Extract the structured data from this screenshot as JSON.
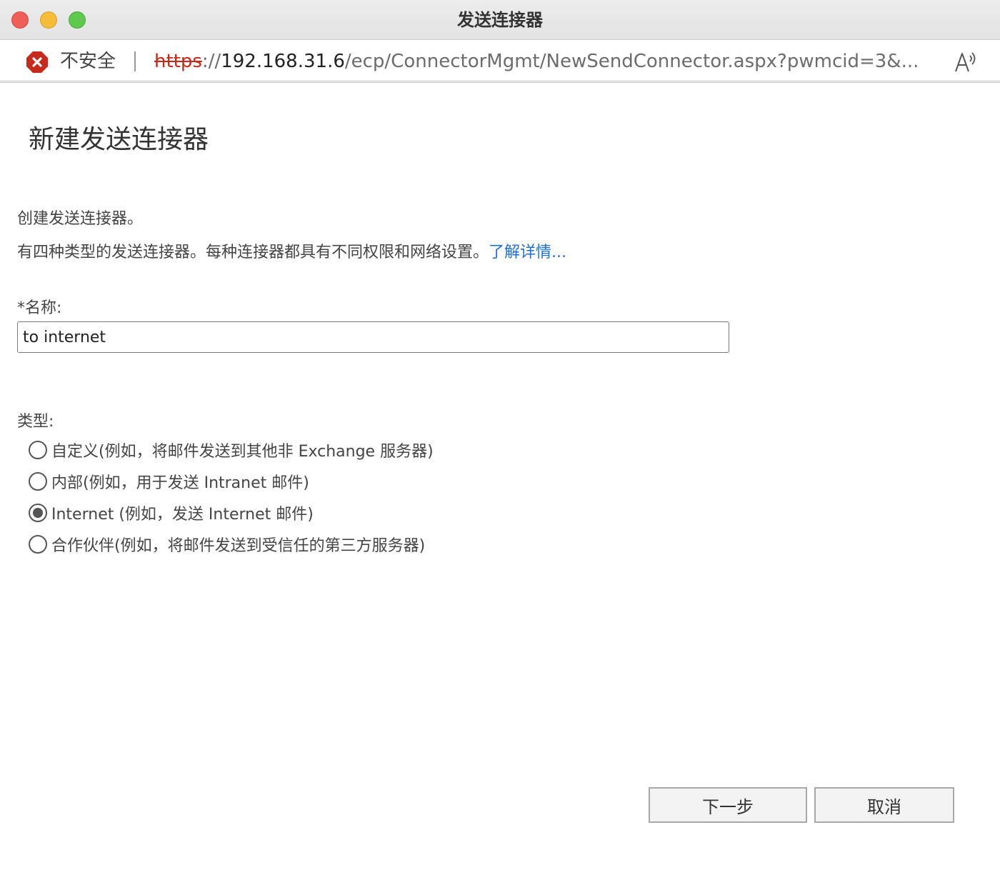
{
  "window": {
    "title": "发送连接器"
  },
  "address_bar": {
    "security_label": "不安全",
    "url_scheme": "https",
    "url_separator": "://",
    "url_host": "192.168.31.6",
    "url_path": "/ecp/ConnectorMgmt/NewSendConnector.aspx?pwmcid=3&..."
  },
  "page": {
    "title": "新建发送连接器",
    "description_1": "创建发送连接器。",
    "description_2": "有四种类型的发送连接器。每种连接器都具有不同权限和网络设置。",
    "learn_more": "了解详情..."
  },
  "form": {
    "name_label": "*名称:",
    "name_value": "to internet",
    "type_label": "类型:",
    "type_options": [
      {
        "label": "自定义(例如，将邮件发送到其他非 Exchange 服务器)",
        "selected": false
      },
      {
        "label": "内部(例如，用于发送 Intranet 邮件)",
        "selected": false
      },
      {
        "label": "Internet (例如，发送 Internet 邮件)",
        "selected": true
      },
      {
        "label": "合作伙伴(例如，将邮件发送到受信任的第三方服务器)",
        "selected": false
      }
    ]
  },
  "buttons": {
    "next": "下一步",
    "cancel": "取消"
  },
  "colors": {
    "link": "#1f6fcf",
    "insecure_red": "#c42b1c"
  }
}
